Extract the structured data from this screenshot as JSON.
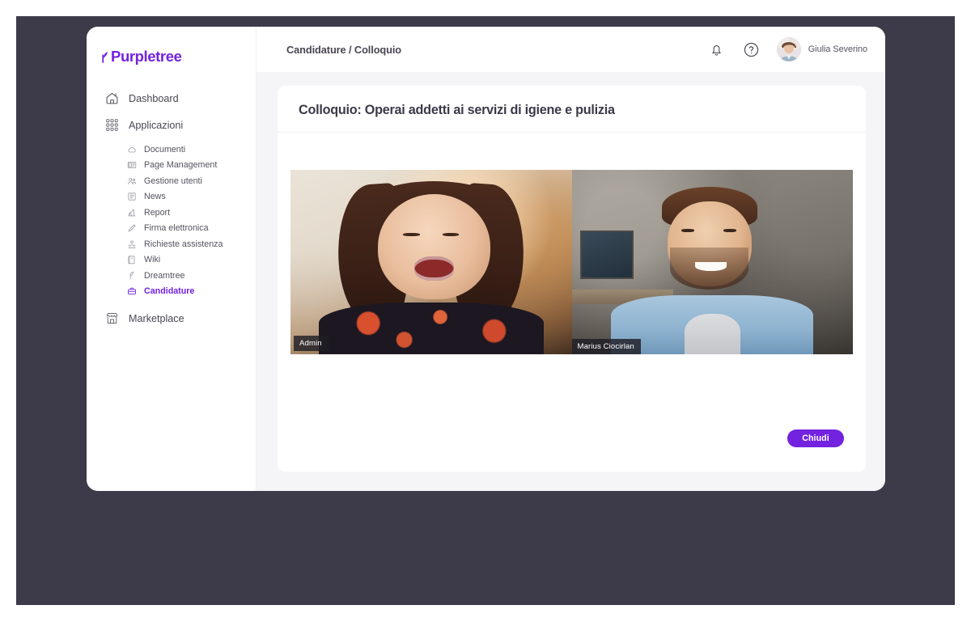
{
  "brand": {
    "name": "Purpletree",
    "color": "#7322e0",
    "leaf_icon": "leaf-sprout-icon"
  },
  "sidebar": {
    "top_items": [
      {
        "label": "Dashboard",
        "icon": "home-icon"
      },
      {
        "label": "Applicazioni",
        "icon": "grid-dots-icon"
      }
    ],
    "sub_items": [
      {
        "label": "Documenti",
        "icon": "document-cloud-icon",
        "active": false
      },
      {
        "label": "Page Management",
        "icon": "page-management-icon",
        "active": false
      },
      {
        "label": "Gestione utenti",
        "icon": "users-icon",
        "active": false
      },
      {
        "label": "News",
        "icon": "news-icon",
        "active": false
      },
      {
        "label": "Report",
        "icon": "chart-report-icon",
        "active": false
      },
      {
        "label": "Firma elettronica",
        "icon": "pen-signature-icon",
        "active": false
      },
      {
        "label": "Richieste assistenza",
        "icon": "support-icon",
        "active": false
      },
      {
        "label": "Wiki",
        "icon": "book-wiki-icon",
        "active": false
      },
      {
        "label": "Dreamtree",
        "icon": "sprout-icon",
        "active": false
      },
      {
        "label": "Candidature",
        "icon": "briefcase-icon",
        "active": true
      }
    ],
    "bottom_items": [
      {
        "label": "Marketplace",
        "icon": "storefront-icon"
      }
    ]
  },
  "topbar": {
    "breadcrumb": "Candidature / Colloquio",
    "notifications_icon": "bell-icon",
    "help_icon": "question-circle-icon",
    "user": {
      "name": "Giulia Severino",
      "avatar": "user-avatar"
    }
  },
  "page": {
    "title": "Colloquio: Operai addetti ai servizi di igiene e pulizia"
  },
  "video_call": {
    "participants": [
      {
        "name": "Admin",
        "focused": true
      },
      {
        "name": "Marius Ciocirlan",
        "focused": false
      }
    ]
  },
  "actions": {
    "close_label": "Chiudi"
  }
}
